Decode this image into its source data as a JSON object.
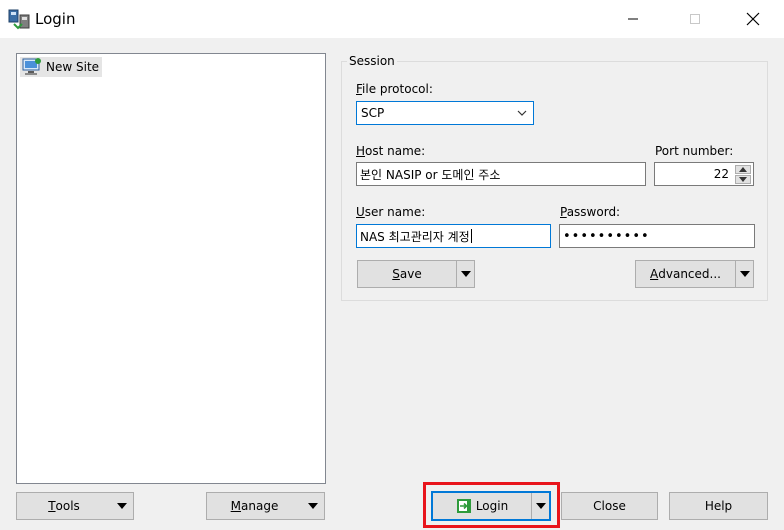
{
  "window": {
    "title": "Login",
    "icon": "winscp-icon",
    "controls": {
      "minimize": "minimize-icon",
      "maximize": "maximize-icon",
      "close": "close-icon"
    }
  },
  "site_tree": {
    "items": [
      {
        "label": "New Site",
        "icon": "computer-site-icon",
        "selected": true
      }
    ]
  },
  "session": {
    "legend": "Session",
    "file_protocol": {
      "label": "File protocol:",
      "value": "SCP",
      "options": [
        "SCP"
      ]
    },
    "host_name": {
      "label": "Host name:",
      "value": "본인 NASIP or 도메인 주소"
    },
    "port_number": {
      "label": "Port number:",
      "value": "22"
    },
    "user_name": {
      "label": "User name:",
      "value": "NAS 최고관리자 계정"
    },
    "password": {
      "label": "Password:",
      "value": "••••••••••"
    },
    "save_label": "Save",
    "advanced_label": "Advanced..."
  },
  "footer": {
    "tools_label": "Tools",
    "manage_label": "Manage",
    "login_label": "Login",
    "close_label": "Close",
    "help_label": "Help"
  },
  "colors": {
    "accent": "#0078d7",
    "highlight": "#e8141b",
    "login_icon": "#2e9b3c"
  }
}
